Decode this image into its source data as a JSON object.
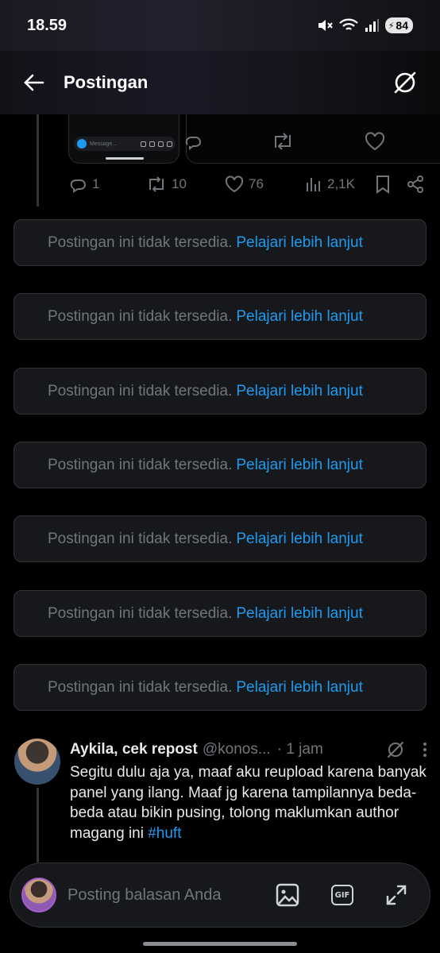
{
  "status_bar": {
    "time": "18.59",
    "battery": "84",
    "icons": [
      "mute-icon",
      "wifi-icon",
      "signal-icon",
      "battery-icon"
    ]
  },
  "header": {
    "title": "Postingan",
    "icons": [
      "back-arrow-icon",
      "grok-icon"
    ]
  },
  "media": {
    "input_placeholder": "Message..."
  },
  "actions": {
    "replies": "1",
    "reposts": "10",
    "likes": "76",
    "views": "2,1K"
  },
  "unavailable_posts": [
    {
      "message": "Postingan ini tidak tersedia.",
      "link": "Pelajari lebih lanjut"
    },
    {
      "message": "Postingan ini tidak tersedia.",
      "link": "Pelajari lebih lanjut"
    },
    {
      "message": "Postingan ini tidak tersedia.",
      "link": "Pelajari lebih lanjut"
    },
    {
      "message": "Postingan ini tidak tersedia.",
      "link": "Pelajari lebih lanjut"
    },
    {
      "message": "Postingan ini tidak tersedia.",
      "link": "Pelajari lebih lanjut"
    },
    {
      "message": "Postingan ini tidak tersedia.",
      "link": "Pelajari lebih lanjut"
    },
    {
      "message": "Postingan ini tidak tersedia.",
      "link": "Pelajari lebih lanjut"
    }
  ],
  "reply": {
    "name": "Aykila, cek repost",
    "handle": "@konos...",
    "time": "· 1 jam",
    "text": "Segitu dulu aja ya, maaf aku reupload karena banyak panel yang ilang. Maaf jg karena tampilannya beda-beda atau bikin pusing, tolong maklumkan author magang ini ",
    "hashtag": "#huft"
  },
  "composer": {
    "placeholder": "Posting balasan Anda",
    "gif_label": "GIF"
  },
  "colors": {
    "background": "#000000",
    "card": "#16181c",
    "link": "#1d9bf0",
    "muted": "#71767b"
  }
}
